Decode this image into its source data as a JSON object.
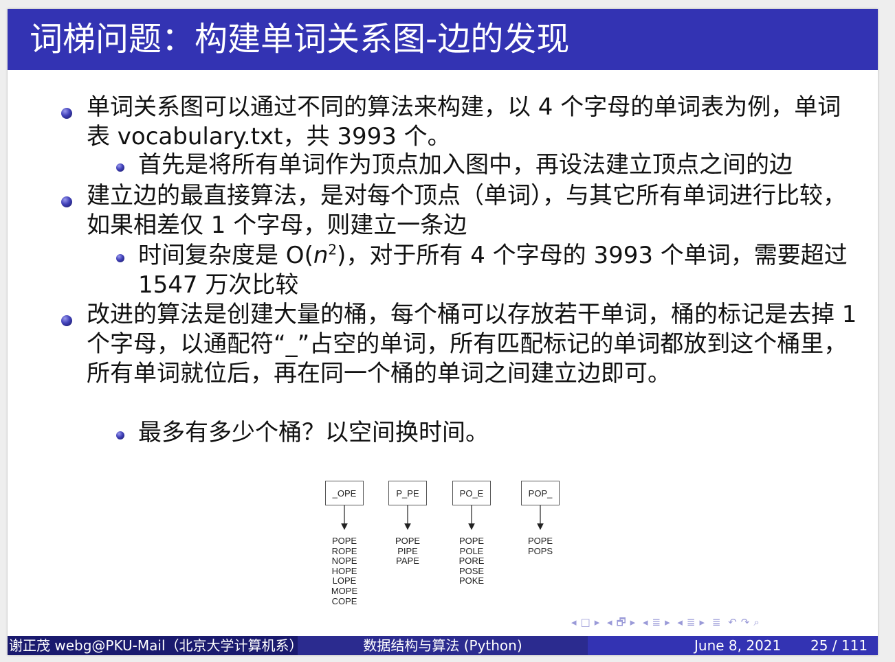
{
  "title": "词梯问题：构建单词关系图-边的发现",
  "bullets": [
    {
      "text": "单词关系图可以通过不同的算法来构建，以 4 个字母的单词表为例，单词表 vocabulary.txt，共 3993 个。",
      "sub": [
        "首先是将所有单词作为顶点加入图中，再设法建立顶点之间的边"
      ]
    },
    {
      "text": "建立边的最直接算法，是对每个顶点（单词），与其它所有单词进行比较，如果相差仅 1 个字母，则建立一条边",
      "sub_pre": "时间复杂度是 O(",
      "sub_var": "n",
      "sub_exp": "2",
      "sub_post": ")，对于所有 4 个字母的 3993 个单词，需要超过 1547 万次比较"
    },
    {
      "text": "改进的算法是创建大量的桶，每个桶可以存放若干单词，桶的标记是去掉 1 个字母，以通配符“_”占空的单词，所有匹配标记的单词都放到这个桶里，所有单词就位后，再在同一个桶的单词之间建立边即可。",
      "sub": [
        "最多有多少个桶？以空间换时间。"
      ]
    }
  ],
  "buckets": [
    {
      "label": "_OPE",
      "words": "POPE\nROPE\nNOPE\nHOPE\nLOPE\nMOPE\nCOPE"
    },
    {
      "label": "P_PE",
      "words": "POPE\nPIPE\nPAPE"
    },
    {
      "label": "PO_E",
      "words": "POPE\nPOLE\nPORE\nPOSE\nPOKE"
    },
    {
      "label": "POP_",
      "words": "POPE\nPOPS"
    }
  ],
  "nav_symbols": [
    "◂",
    "□",
    "▸",
    "◂",
    "🗗",
    "▸",
    "◂",
    "≣",
    "▸",
    "◂",
    "≣",
    "▸",
    "≣",
    "↶",
    "↷",
    "⌕"
  ],
  "footer": {
    "author": "谢正茂 webg@PKU-Mail（北京大学计算机系）",
    "course": "数据结构与算法 (Python)",
    "date": "June 8, 2021",
    "page": "25 / 111"
  }
}
